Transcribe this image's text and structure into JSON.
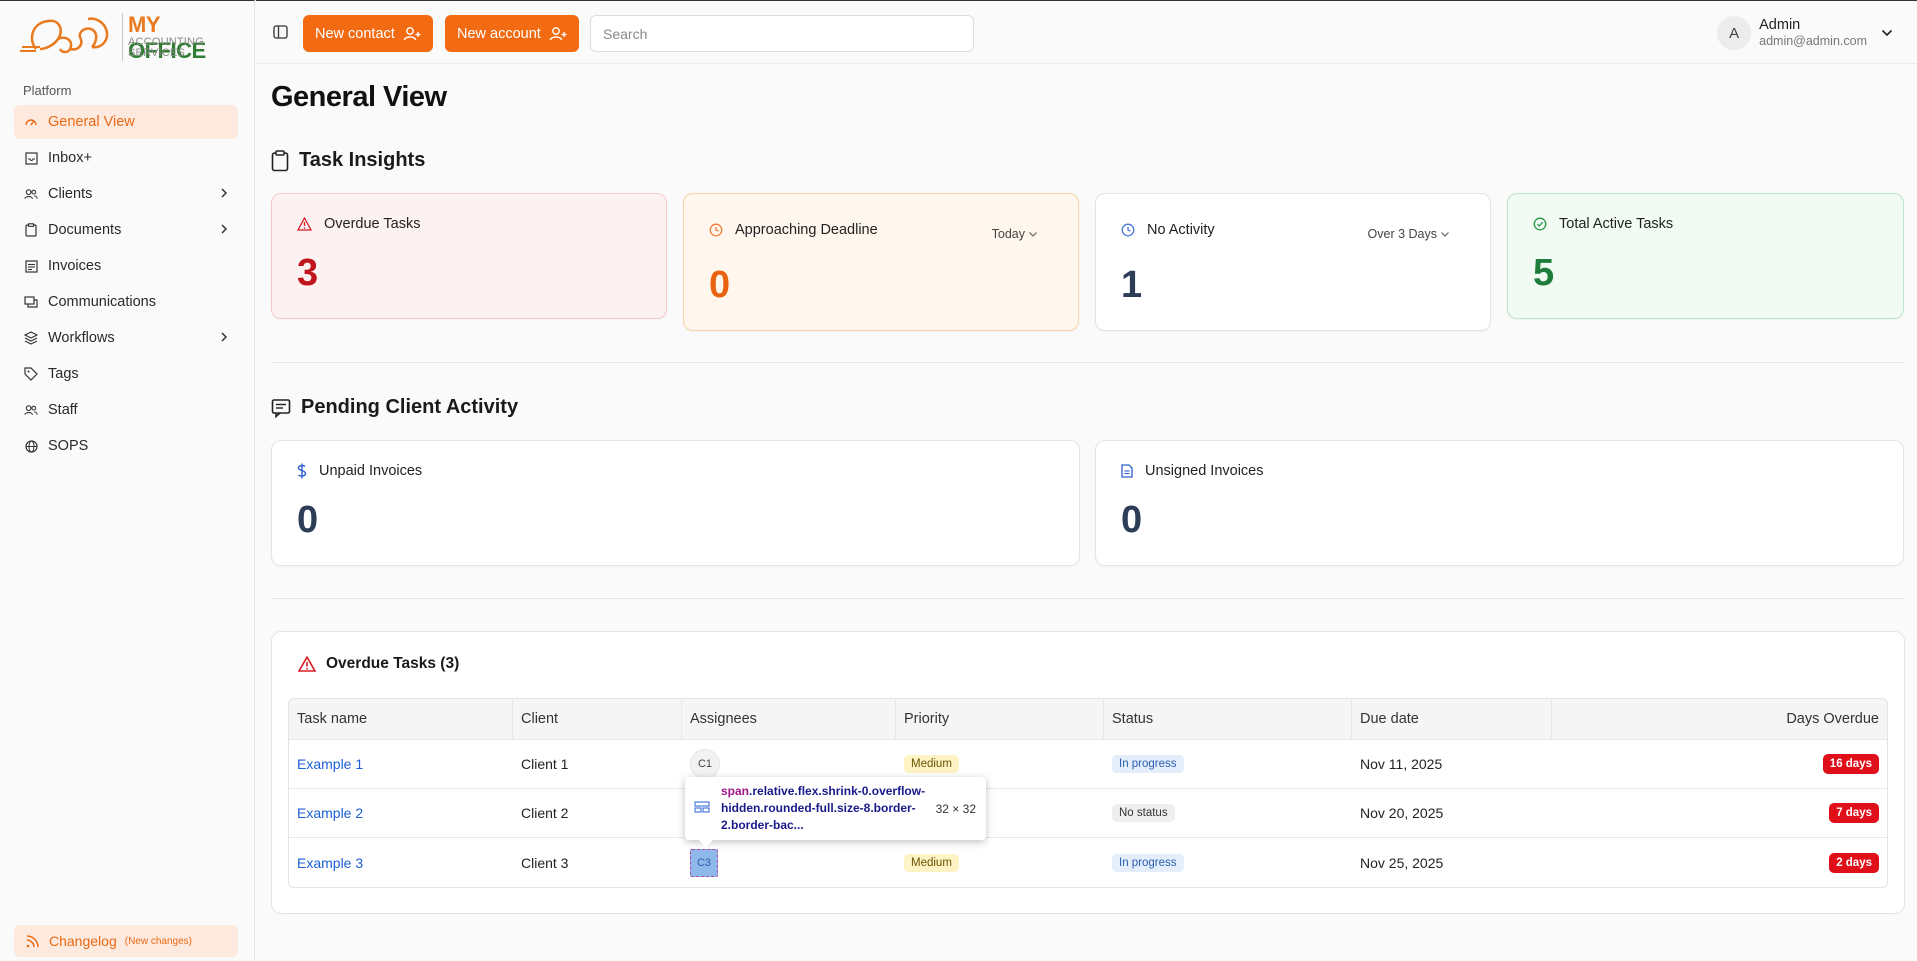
{
  "brand": {
    "word1": "MY",
    "word2": "OFFICE",
    "line1": "ACCOUNTING",
    "line2": "SERVICES",
    "accent": "#f26a12",
    "green": "#2e7d32"
  },
  "sidebar": {
    "section_label": "Platform",
    "items": [
      {
        "label": "General View",
        "icon": "gauge-icon",
        "active": true
      },
      {
        "label": "Inbox+",
        "icon": "inbox-icon"
      },
      {
        "label": "Clients",
        "icon": "users-icon",
        "expandable": true
      },
      {
        "label": "Documents",
        "icon": "clipboard-icon",
        "expandable": true
      },
      {
        "label": "Invoices",
        "icon": "receipt-icon"
      },
      {
        "label": "Communications",
        "icon": "messages-icon"
      },
      {
        "label": "Workflows",
        "icon": "layers-icon",
        "expandable": true
      },
      {
        "label": "Tags",
        "icon": "tag-icon"
      },
      {
        "label": "Staff",
        "icon": "users-icon"
      },
      {
        "label": "SOPS",
        "icon": "globe-icon"
      }
    ],
    "changelog": {
      "label": "Changelog",
      "note": "(New changes)"
    }
  },
  "topbar": {
    "new_contact": "New contact",
    "new_account": "New account",
    "search_placeholder": "Search",
    "user": {
      "initial": "A",
      "name": "Admin",
      "email": "admin@admin.com"
    }
  },
  "page": {
    "title": "General View"
  },
  "task_insights": {
    "title": "Task Insights",
    "cards": [
      {
        "label": "Overdue Tasks",
        "value": "3",
        "color": "#c0151d"
      },
      {
        "label": "Approaching Deadline",
        "value": "0",
        "filter": "Today",
        "color": "#e9620f"
      },
      {
        "label": "No Activity",
        "value": "1",
        "filter": "Over 3 Days",
        "color": "#2d3c57"
      },
      {
        "label": "Total Active Tasks",
        "value": "5",
        "color": "#1e7d3a"
      }
    ]
  },
  "pending": {
    "title": "Pending Client Activity",
    "cards": [
      {
        "label": "Unpaid Invoices",
        "value": "0"
      },
      {
        "label": "Unsigned Invoices",
        "value": "0"
      }
    ]
  },
  "overdue_table": {
    "title": "Overdue Tasks (3)",
    "headers": [
      "Task name",
      "Client",
      "Assignees",
      "Priority",
      "Status",
      "Due date",
      "Days Overdue"
    ],
    "rows": [
      {
        "task": "Example 1",
        "client": "Client 1",
        "assignee": "C1",
        "priority": "Medium",
        "status": "In progress",
        "due": "Nov 11, 2025",
        "overdue": "16 days"
      },
      {
        "task": "Example 2",
        "client": "Client 2",
        "assignee": "",
        "priority": "",
        "status": "No status",
        "due": "Nov 20, 2025",
        "overdue": "7 days"
      },
      {
        "task": "Example 3",
        "client": "Client 3",
        "assignee": "C3",
        "priority": "Medium",
        "status": "In progress",
        "due": "Nov 25, 2025",
        "overdue": "2 days"
      }
    ]
  },
  "inspector": {
    "tag": "span",
    "selector": ".relative.flex.shrink-0.overflow-hidden.rounded-full.size-8.border-2.border-bac...",
    "dims": "32 × 32"
  }
}
